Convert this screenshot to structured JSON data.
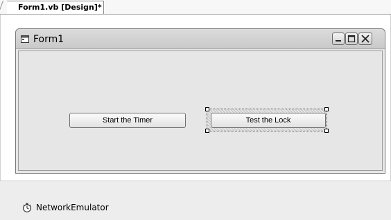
{
  "tab": {
    "label": "Form1.vb [Design]*"
  },
  "form": {
    "title": "Form1",
    "icon": "form-window-icon",
    "controls": {
      "minimize": "minimize-icon",
      "maximize": "maximize-icon",
      "close": "close-icon"
    }
  },
  "buttons": {
    "start_timer": "Start the Timer",
    "test_lock": "Test the Lock"
  },
  "tray": {
    "component_label": "NetworkEmulator",
    "component_icon": "timer-icon"
  },
  "colors": {
    "form_background": "#e6e6e6",
    "tray_background": "#ededed"
  }
}
